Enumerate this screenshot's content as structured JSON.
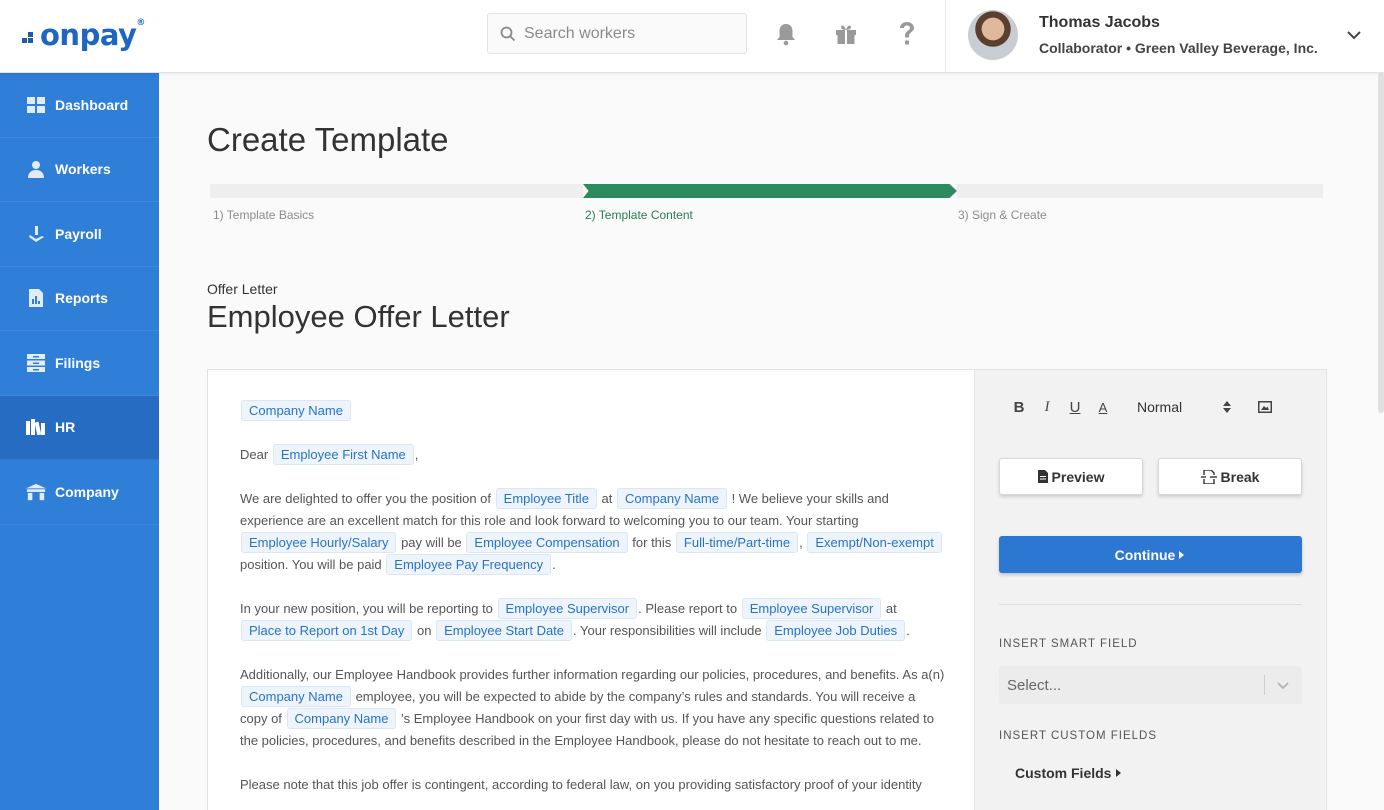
{
  "header": {
    "logo_text": "onpay",
    "logo_mark": "®",
    "search_placeholder": "Search workers",
    "user_name": "Thomas Jacobs",
    "user_role": "Collaborator • Green Valley Beverage, Inc."
  },
  "sidebar": {
    "items": [
      {
        "label": "Dashboard",
        "icon": "dashboard-icon"
      },
      {
        "label": "Workers",
        "icon": "workers-icon"
      },
      {
        "label": "Payroll",
        "icon": "payroll-icon"
      },
      {
        "label": "Reports",
        "icon": "reports-icon"
      },
      {
        "label": "Filings",
        "icon": "filings-icon"
      },
      {
        "label": "HR",
        "icon": "hr-icon"
      },
      {
        "label": "Company",
        "icon": "company-icon"
      }
    ],
    "active": "HR"
  },
  "main": {
    "page_title": "Create Template",
    "steps": [
      {
        "label": "1) Template Basics",
        "state": "complete"
      },
      {
        "label": "2) Template Content",
        "state": "active"
      },
      {
        "label": "3) Sign & Create",
        "state": "upcoming"
      }
    ],
    "doc_type": "Offer Letter",
    "doc_title": "Employee Offer Letter"
  },
  "letter": {
    "company_name": "Company Name",
    "dear": "Dear",
    "first_name": "Employee First Name",
    "comma": ",",
    "p2_a": "We are delighted to offer you the position of",
    "employee_title": "Employee Title",
    "at": "at",
    "p2_b": "! We believe your skills and experience are an excellent match for this role and look forward to welcoming you to our team. Your starting",
    "hourly_salary": "Employee Hourly/Salary",
    "pay_will_be": "pay will be",
    "compensation": "Employee Compensation",
    "for_this": "for this",
    "ft_pt": "Full-time/Part-time",
    "exempt": "Exempt/Non-exempt",
    "paid": "position. You will be paid",
    "pay_frequency": "Employee Pay Frequency",
    "period": ".",
    "p3_a": "In your new position, you will be reporting to",
    "supervisor": "Employee Supervisor",
    "please_report": ". Please report to",
    "place_report": "Place to Report on 1st Day",
    "on": "on",
    "start_date": "Employee Start Date",
    "resp": ". Your responsibilities will include",
    "job_duties": "Employee Job Duties",
    "p4_a": "Additionally, our Employee Handbook provides further information regarding our policies, procedures, and benefits. As a(n)",
    "p4_b": "employee, you will be expected to abide by the company’s rules and standards. You will receive a copy of",
    "p4_c": "'s Employee Handbook on your first day with us. If you have any specific questions related to the policies, procedures, and benefits described in the Employee Handbook, please do not hesitate to reach out to me.",
    "p5": "Please note that this job offer is contingent, according to federal law, on you providing satisfactory proof of your identity"
  },
  "panel": {
    "bold": "B",
    "italic": "I",
    "underline": "U",
    "color": "A",
    "format": "Normal",
    "preview": "Preview",
    "break": "Break",
    "continue": "Continue",
    "insert_smart": "INSERT SMART FIELD",
    "select_placeholder": "Select...",
    "insert_custom": "INSERT CUSTOM FIELDS",
    "custom_fields": "Custom Fields"
  },
  "colors": {
    "sidebar": "#2f7ed8",
    "primary": "#2c77d2",
    "step_active": "#2b8a5e",
    "chip_text": "#2672cc"
  }
}
